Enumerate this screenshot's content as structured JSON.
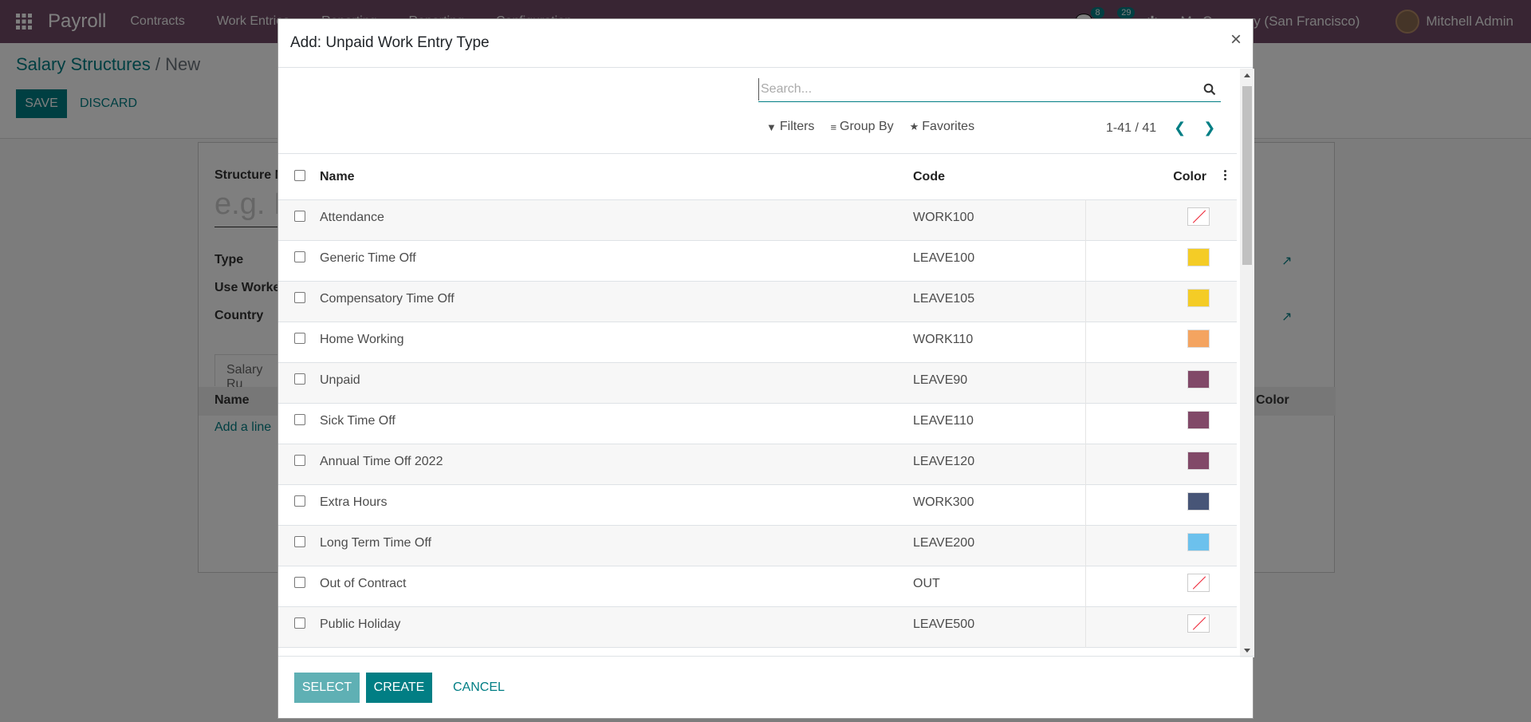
{
  "navbar": {
    "brand": "Payroll",
    "menu": [
      "Contracts",
      "Work Entries",
      "Reporting",
      "Reporting",
      "Configuration"
    ],
    "messages_count": "8",
    "activities_count": "29",
    "company": "My Company (San Francisco)",
    "user": "Mitchell Admin"
  },
  "page": {
    "breadcrumb_parent": "Salary Structures",
    "breadcrumb_current": " / New",
    "save_label": "SAVE",
    "discard_label": "DISCARD",
    "fields": {
      "structure_name": "Structure N",
      "name_placeholder": "e.g. I",
      "type": "Type",
      "use_worked": "Use Worke",
      "country": "Country"
    },
    "tab_label": "Salary Ru",
    "list_name_col": "Name",
    "list_color_col": "Color",
    "add_line": "Add a line"
  },
  "modal": {
    "title": "Add: Unpaid Work Entry Type",
    "close": "×",
    "search_placeholder": "Search...",
    "filters_label": "Filters",
    "group_by_label": "Group By",
    "favorites_label": "Favorites",
    "pager": "1-41 / 41",
    "columns": {
      "name": "Name",
      "code": "Code",
      "color": "Color"
    },
    "rows": [
      {
        "name": "Attendance",
        "code": "WORK100",
        "color": "none"
      },
      {
        "name": "Generic Time Off",
        "code": "LEAVE100",
        "color": "#f4cc26"
      },
      {
        "name": "Compensatory Time Off",
        "code": "LEAVE105",
        "color": "#f4cc26"
      },
      {
        "name": "Home Working",
        "code": "WORK110",
        "color": "#f4a460"
      },
      {
        "name": "Unpaid",
        "code": "LEAVE90",
        "color": "#814968"
      },
      {
        "name": "Sick Time Off",
        "code": "LEAVE110",
        "color": "#814968"
      },
      {
        "name": "Annual Time Off 2022",
        "code": "LEAVE120",
        "color": "#814968"
      },
      {
        "name": "Extra Hours",
        "code": "WORK300",
        "color": "#475577"
      },
      {
        "name": "Long Term Time Off",
        "code": "LEAVE200",
        "color": "#6cc1ed"
      },
      {
        "name": "Out of Contract",
        "code": "OUT",
        "color": "none"
      },
      {
        "name": "Public Holiday",
        "code": "LEAVE500",
        "color": "none"
      }
    ],
    "select_label": "SELECT",
    "create_label": "CREATE",
    "cancel_label": "CANCEL"
  },
  "colors": {
    "navbar": "#714B67",
    "accent": "#017e84"
  }
}
